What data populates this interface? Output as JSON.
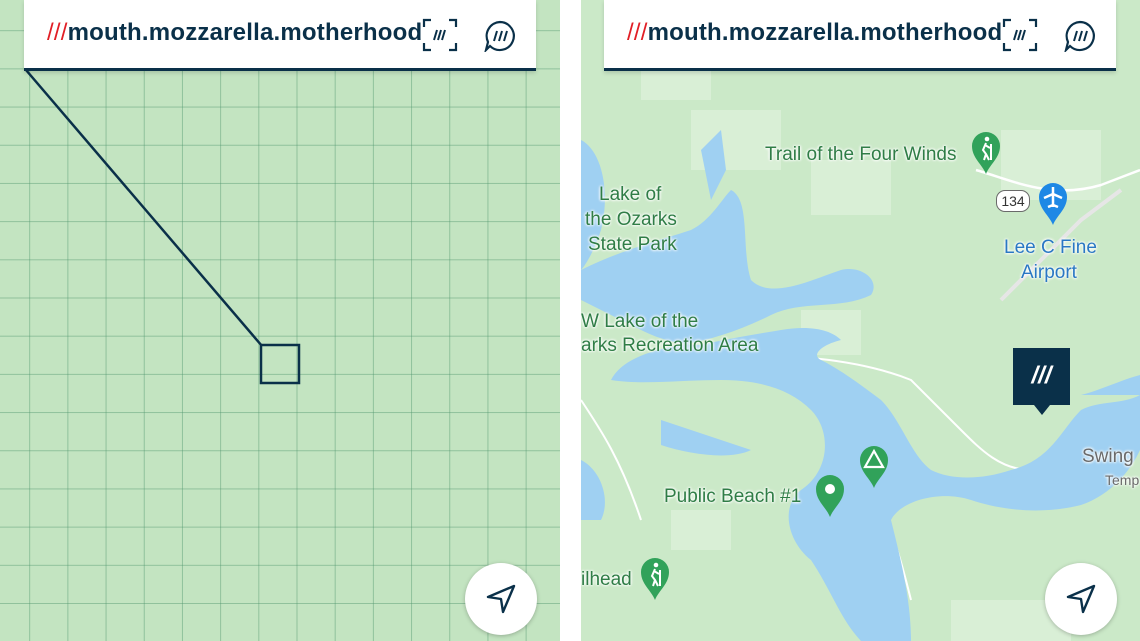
{
  "grid_view": {
    "address_prefix": "///",
    "address": "mouth.mozzarella.motherhood",
    "icons": [
      "scan-icon",
      "chat-icon",
      "navigate-arrow-icon"
    ]
  },
  "map_view": {
    "address_prefix": "///",
    "address": "mouth.mozzarella.motherhood",
    "marker_text": "///",
    "labels": {
      "trail_four_winds": "Trail of the Four Winds",
      "lake_park_1": "Lake of",
      "lake_park_2": "the Ozarks",
      "lake_park_3": "State Park",
      "route": "134",
      "airport_1": "Lee C Fine",
      "airport_2": "Airport",
      "nw_lake_1": "W Lake of the",
      "nw_lake_2": "arks Recreation Area",
      "public_beach": "Public Beach #1",
      "swing": "Swing",
      "temp": "Temp",
      "trailhead": "ilhead"
    },
    "icons": [
      "hiking-icon",
      "airport-icon",
      "campground-icon",
      "pin-icon",
      "scan-icon",
      "chat-icon",
      "navigate-arrow-icon"
    ]
  },
  "colors": {
    "brand_navy": "#0a3049",
    "brand_red": "#e11f26",
    "water": "#9fd0f2",
    "land": "#cbe9c8",
    "poi_green": "#31a25a",
    "airport_blue": "#1e88e5"
  }
}
